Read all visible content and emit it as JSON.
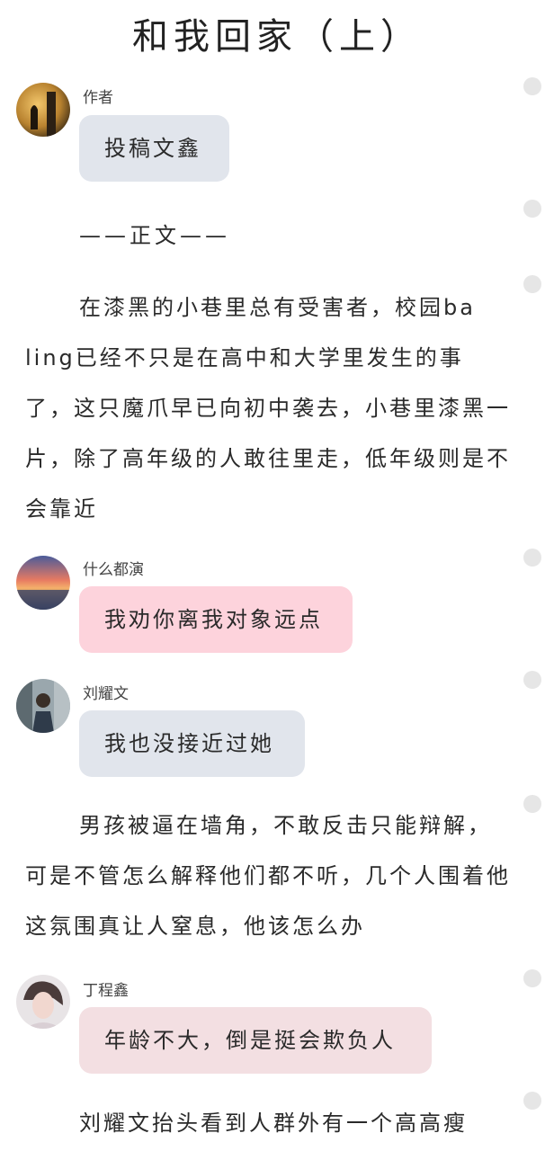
{
  "title": "和我回家（上）",
  "posts": [
    {
      "name": "作者",
      "bubble": "投稿文鑫"
    },
    {
      "name": "什么都演",
      "bubble": "我劝你离我对象远点"
    },
    {
      "name": "刘耀文",
      "bubble": "我也没接近过她"
    },
    {
      "name": "丁程鑫",
      "bubble": "年龄不大，倒是挺会欺负人"
    }
  ],
  "separator": "——正文——",
  "paragraphs": [
    "在漆黑的小巷里总有受害者，校园ba ling已经不只是在高中和大学里发生的事了，这只魔爪早已向初中袭去，小巷里漆黑一片，除了高年级的人敢往里走，低年级则是不会靠近",
    "男孩被逼在墙角，不敢反击只能辩解，可是不管怎么解释他们都不听，几个人围着他这氛围真让人窒息，他该怎么办",
    "刘耀文抬头看到人群外有一个高高瘦"
  ]
}
